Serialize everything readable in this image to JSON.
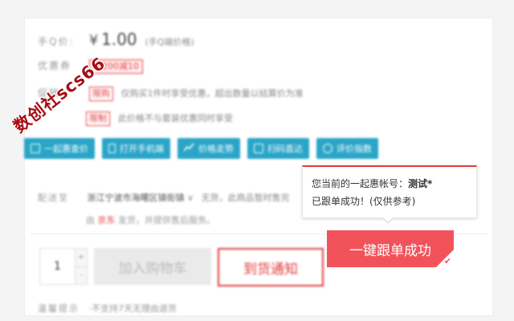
{
  "product": {
    "mobile_price_label": "手Q价:",
    "price_currency": "¥",
    "price_value": "1.00",
    "price_note": "(手Q端价格)",
    "coupon_label": "优惠券",
    "coupon_badge": "满200减10",
    "promo_label": "促销",
    "promo_items": [
      {
        "tag": "限购",
        "text": "仅购买1件时享受优惠，超出数量以结算价为准"
      },
      {
        "tag": "限制",
        "text": "此价格不与套装优惠同时享受"
      }
    ]
  },
  "tools": [
    {
      "label": "一起惠查价",
      "icon": "list-icon"
    },
    {
      "label": "打开手机端",
      "icon": "phone-icon"
    },
    {
      "label": "价格走势",
      "icon": "chart-icon"
    },
    {
      "label": "扫码直达",
      "icon": "qrcode-icon"
    },
    {
      "label": "评价指数",
      "icon": "check-circle-icon"
    }
  ],
  "shipping": {
    "label": "配送至",
    "location": "浙江宁波市海曙区镇街镇",
    "stock": "无货，此商品暂时售完",
    "source_prefix": "由",
    "seller": "京东",
    "source_suffix": "发货，并提供售后服务。"
  },
  "purchase": {
    "quantity": "1",
    "plus": "+",
    "minus": "-",
    "add_to_cart": "加入购物车",
    "notify": "到货通知",
    "one_key": "一键跟单成功"
  },
  "tips": {
    "label": "温馨提示",
    "text": "·不支持7天无理由退货"
  },
  "tooltip": {
    "line1_prefix": "您当前的一起惠帐号：",
    "account": "测试*",
    "line2": "已跟单成功！(仅供参考)"
  },
  "watermark": "数创社scs66",
  "colors": {
    "accent_red": "#e4393c",
    "button_red": "#f2535a",
    "tool_blue": "#2aa5c8"
  }
}
